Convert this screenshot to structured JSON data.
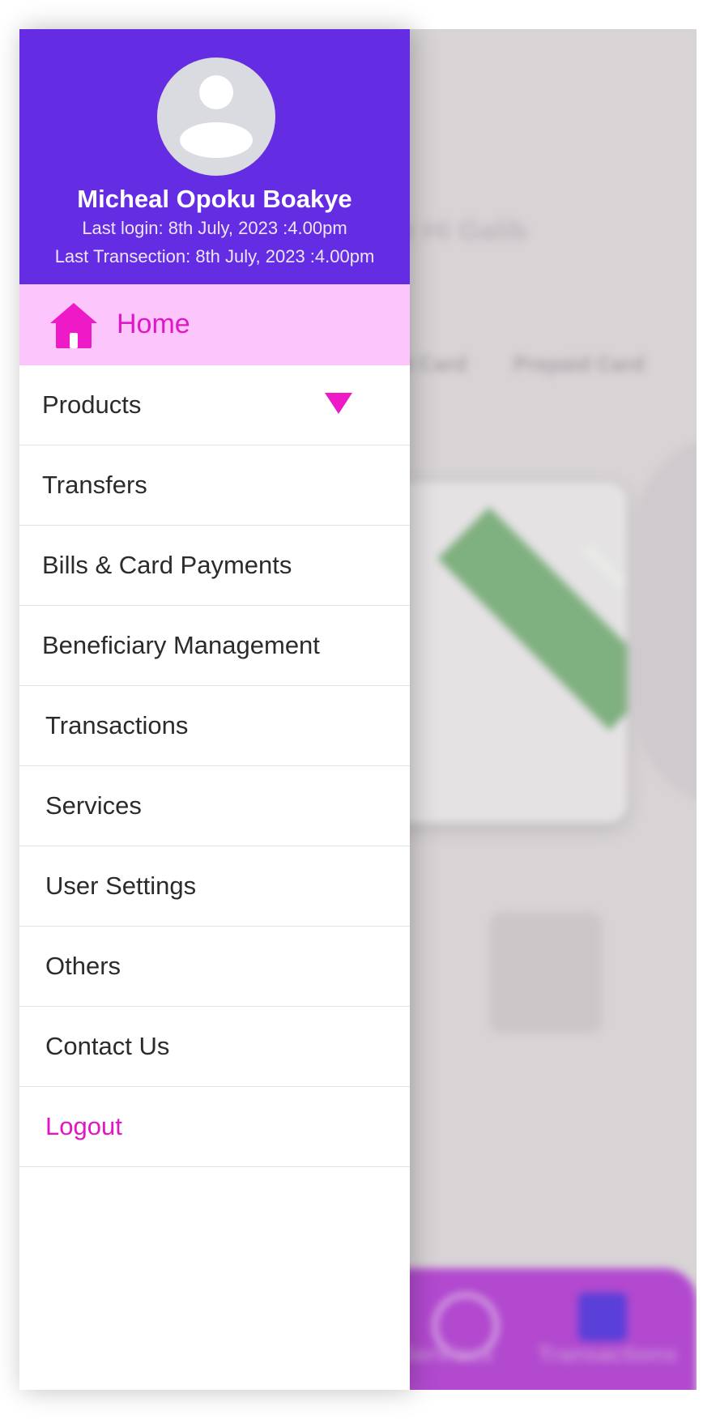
{
  "user": {
    "name": "Micheal Opoku Boakye",
    "last_login": "Last login: 8th July, 2023 :4.00pm",
    "last_transaction": "Last Transection: 8th July, 2023 :4.00pm"
  },
  "drawer": {
    "home_label": "Home",
    "items": [
      {
        "label": "Products"
      },
      {
        "label": "Transfers"
      },
      {
        "label": "Bills & Card Payments"
      },
      {
        "label": "Beneficiary Management"
      },
      {
        "label": "Transactions"
      },
      {
        "label": "Services"
      },
      {
        "label": "User Settings"
      },
      {
        "label": "Others"
      },
      {
        "label": "Contact Us"
      },
      {
        "label": "Logout"
      }
    ]
  },
  "background": {
    "greeting": "e Hi Galib",
    "tab_1": "it Card",
    "tab_2": "Prepaid Card",
    "ribbon": "Active",
    "bottom_label_1": "Services",
    "bottom_label_2": "Transactions"
  },
  "colors": {
    "header_bg": "#652de3",
    "home_bg": "#fcc6fc",
    "accent_pink": "#e315c5"
  },
  "icons": {
    "avatar": "user-avatar-icon",
    "home": "home-icon",
    "products_expand": "triangle-down-icon"
  }
}
